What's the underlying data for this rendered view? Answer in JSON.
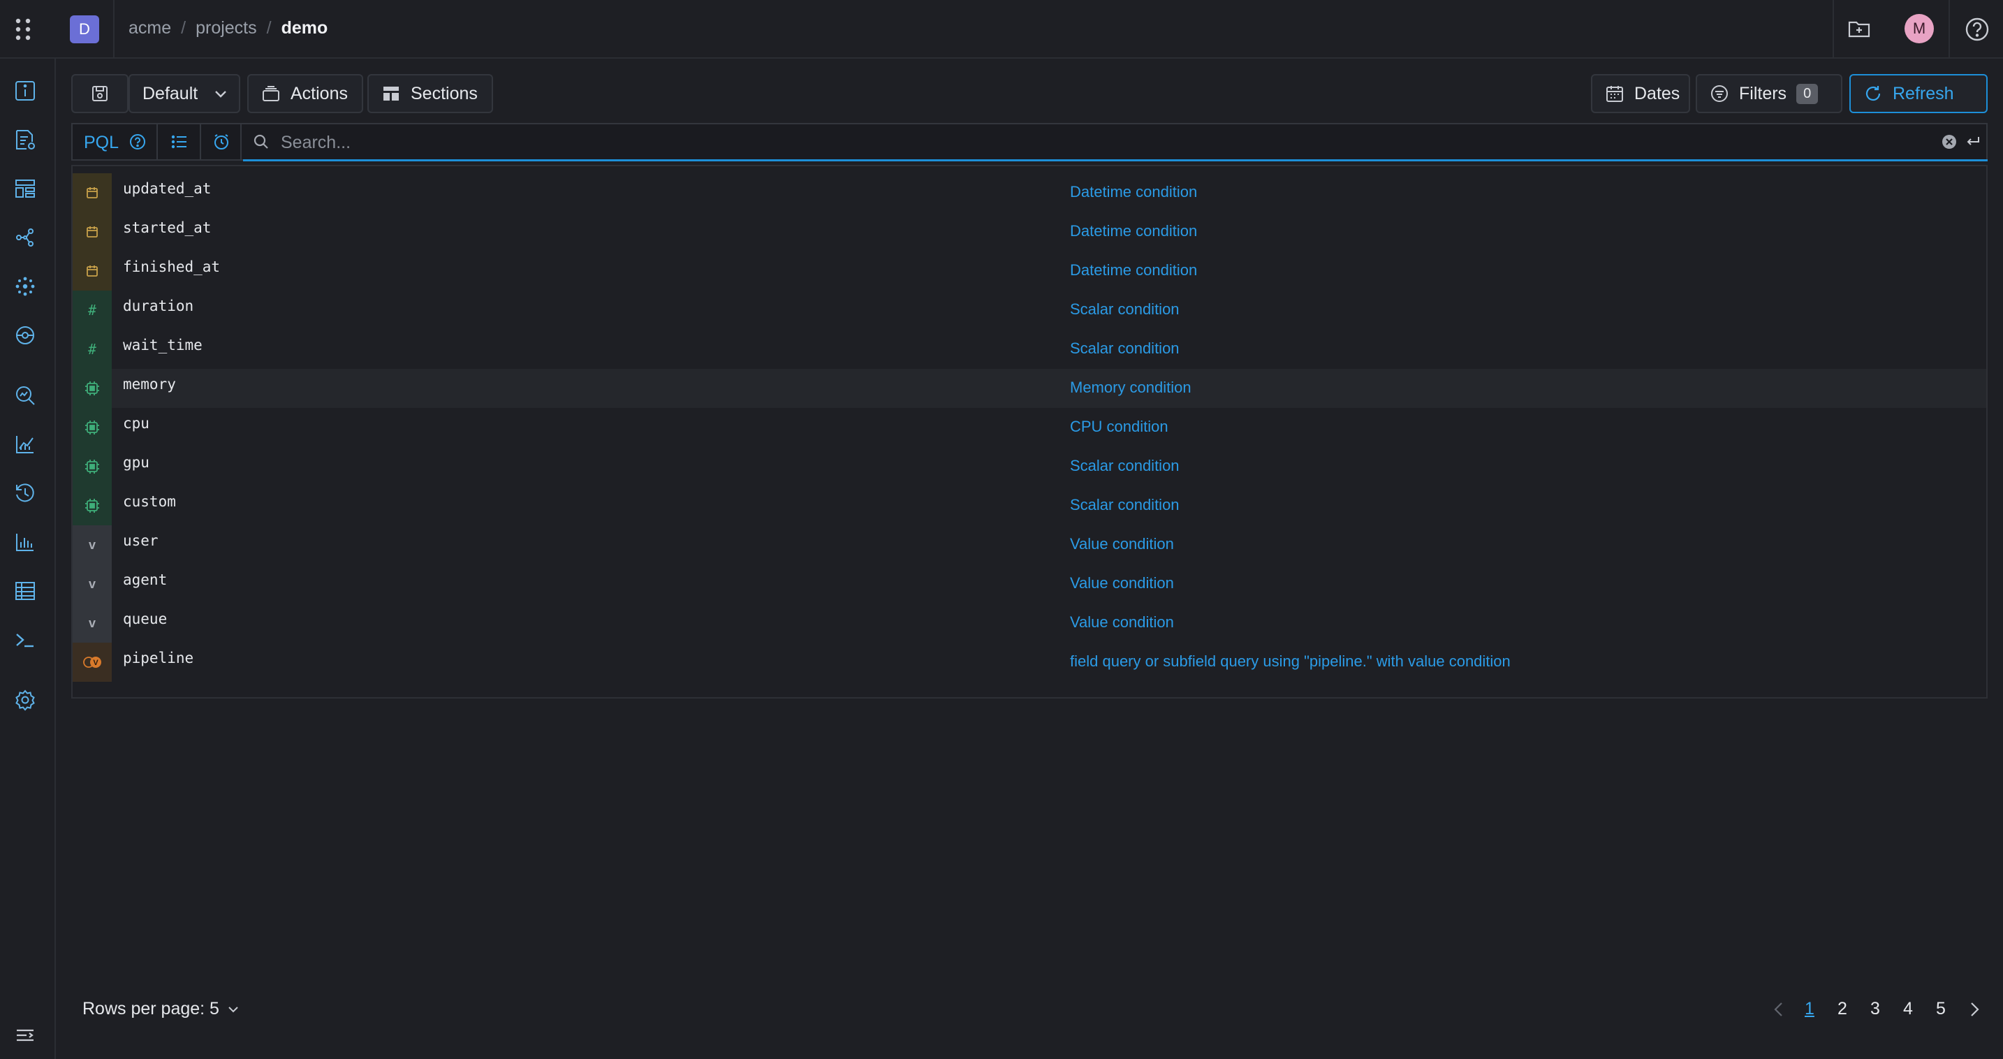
{
  "header": {
    "project_initial": "D",
    "breadcrumb": [
      "acme",
      "projects",
      "demo"
    ],
    "user_initial": "M"
  },
  "toolbar": {
    "view_name": "Default",
    "actions_label": "Actions",
    "sections_label": "Sections",
    "dates_label": "Dates",
    "filters_label": "Filters",
    "filters_count": "0",
    "refresh_label": "Refresh"
  },
  "search": {
    "mode_label": "PQL",
    "placeholder": "Search..."
  },
  "suggestions": [
    {
      "field": "updated_at",
      "description": "Datetime condition",
      "kind": "calendar-icon"
    },
    {
      "field": "started_at",
      "description": "Datetime condition",
      "kind": "calendar-icon"
    },
    {
      "field": "finished_at",
      "description": "Datetime condition",
      "kind": "calendar-icon"
    },
    {
      "field": "duration",
      "description": "Scalar condition",
      "kind": "hash-icon"
    },
    {
      "field": "wait_time",
      "description": "Scalar condition",
      "kind": "hash-icon"
    },
    {
      "field": "memory",
      "description": "Memory condition",
      "kind": "chip-icon"
    },
    {
      "field": "cpu",
      "description": "CPU condition",
      "kind": "chip-icon"
    },
    {
      "field": "gpu",
      "description": "Scalar condition",
      "kind": "chip-icon"
    },
    {
      "field": "custom",
      "description": "Scalar condition",
      "kind": "chip-icon"
    },
    {
      "field": "user",
      "description": "Value condition",
      "kind": "value-icon"
    },
    {
      "field": "agent",
      "description": "Value condition",
      "kind": "value-icon"
    },
    {
      "field": "queue",
      "description": "Value condition",
      "kind": "value-icon"
    },
    {
      "field": "pipeline",
      "description": "field query or subfield query using \"pipeline.\" with value condition",
      "kind": "pipeline-icon"
    }
  ],
  "footer": {
    "rows_per_page_label": "Rows per page: 5",
    "pages": [
      "1",
      "2",
      "3",
      "4",
      "5"
    ],
    "current_page": "1"
  },
  "colors": {
    "accent": "#1d8fd8",
    "background": "#1e1f24",
    "project_avatar": "#6b6fd6",
    "user_avatar": "#e8a3c4"
  }
}
